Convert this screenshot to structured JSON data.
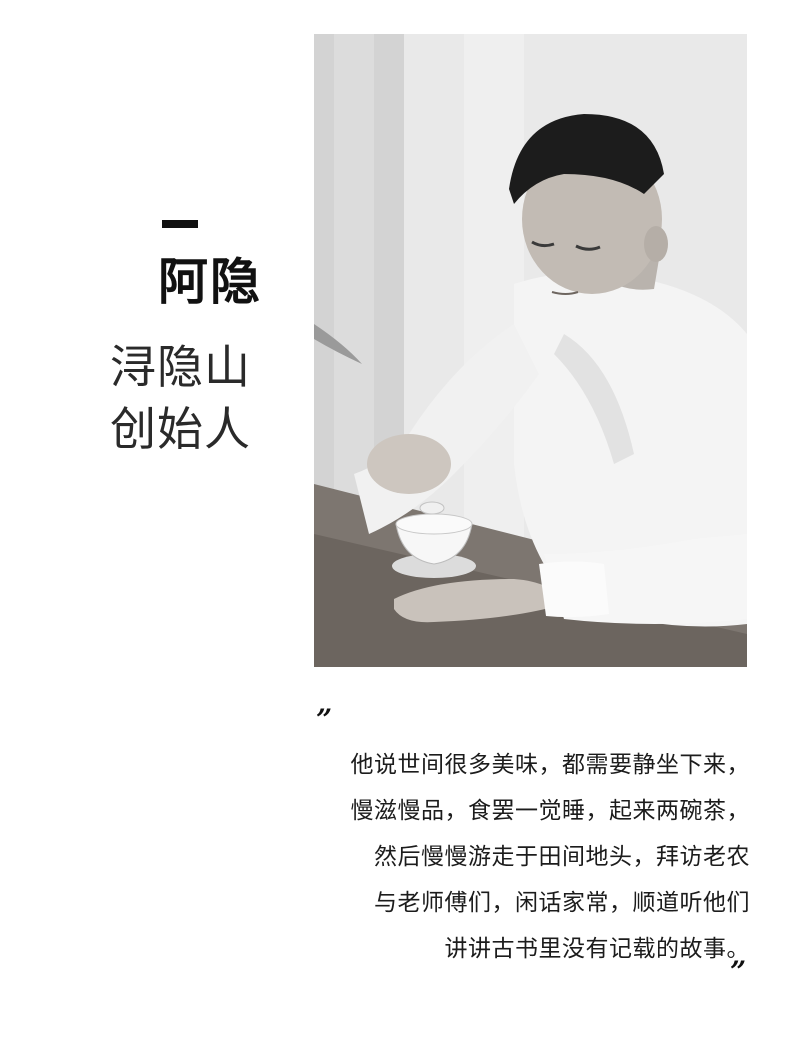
{
  "profile": {
    "name": "阿隐",
    "role_lines": [
      "浔隐山",
      "创始人"
    ]
  },
  "photo": {
    "description_icon": "portrait-photo"
  },
  "quote": {
    "open_mark": "”",
    "close_mark": "”",
    "lines": [
      "他说世间很多美味，都需要静坐下来，",
      "慢滋慢品，食罢一觉睡，起来两碗茶，",
      "然后慢慢游走于田间地头，拜访老农",
      "与老师傅们，闲话家常，顺道听他们",
      "讲讲古书里没有记载的故事。"
    ]
  }
}
